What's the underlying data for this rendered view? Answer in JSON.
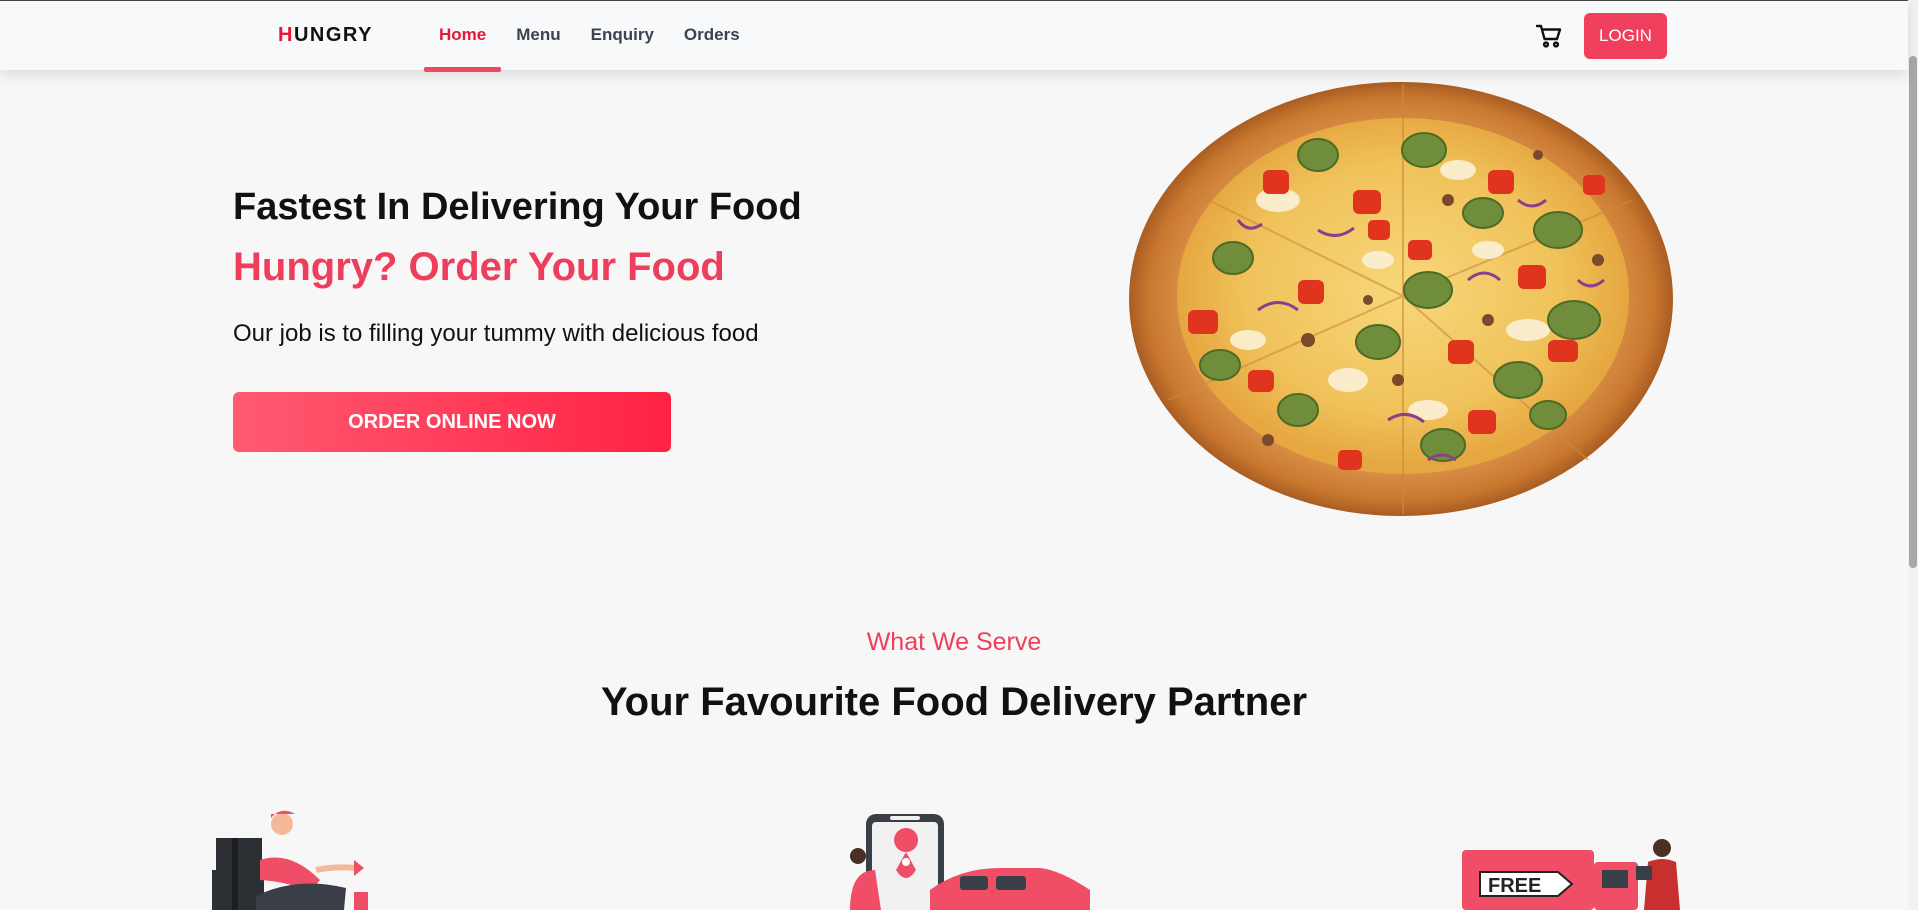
{
  "brand": {
    "first_letter": "H",
    "rest": "UNGRY"
  },
  "nav": {
    "links": [
      {
        "label": "Home",
        "active": true
      },
      {
        "label": "Menu",
        "active": false
      },
      {
        "label": "Enquiry",
        "active": false
      },
      {
        "label": "Orders",
        "active": false
      }
    ],
    "cart_icon": "cart-icon",
    "login_label": "LOGIN"
  },
  "hero": {
    "title": "Fastest In Delivering Your Food",
    "subtitle": "Hungry? Order Your Food",
    "description": "Our job is to filling your tummy with delicious food",
    "cta_label": "ORDER ONLINE NOW",
    "image": "pizza-image"
  },
  "section": {
    "kicker": "What We Serve",
    "title": "Your Favourite Food Delivery Partner",
    "illustrations": [
      "delivery-man-illustration",
      "map-car-illustration",
      "free-delivery-truck-illustration"
    ],
    "free_label": "FREE"
  },
  "colors": {
    "accent": "#ee3e5b",
    "brand_red": "#e8173a",
    "cta_gradient_start": "#ff5a72",
    "cta_gradient_end": "#ff2243",
    "background": "#f7f7f8"
  }
}
